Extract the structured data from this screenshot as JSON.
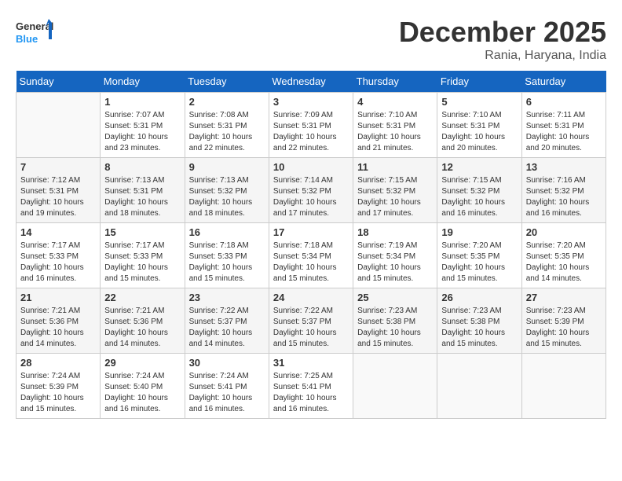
{
  "header": {
    "logo_line1": "General",
    "logo_line2": "Blue",
    "month": "December 2025",
    "location": "Rania, Haryana, India"
  },
  "days_of_week": [
    "Sunday",
    "Monday",
    "Tuesday",
    "Wednesday",
    "Thursday",
    "Friday",
    "Saturday"
  ],
  "weeks": [
    [
      {
        "day": "",
        "sunrise": "",
        "sunset": "",
        "daylight": ""
      },
      {
        "day": "1",
        "sunrise": "Sunrise: 7:07 AM",
        "sunset": "Sunset: 5:31 PM",
        "daylight": "Daylight: 10 hours and 23 minutes."
      },
      {
        "day": "2",
        "sunrise": "Sunrise: 7:08 AM",
        "sunset": "Sunset: 5:31 PM",
        "daylight": "Daylight: 10 hours and 22 minutes."
      },
      {
        "day": "3",
        "sunrise": "Sunrise: 7:09 AM",
        "sunset": "Sunset: 5:31 PM",
        "daylight": "Daylight: 10 hours and 22 minutes."
      },
      {
        "day": "4",
        "sunrise": "Sunrise: 7:10 AM",
        "sunset": "Sunset: 5:31 PM",
        "daylight": "Daylight: 10 hours and 21 minutes."
      },
      {
        "day": "5",
        "sunrise": "Sunrise: 7:10 AM",
        "sunset": "Sunset: 5:31 PM",
        "daylight": "Daylight: 10 hours and 20 minutes."
      },
      {
        "day": "6",
        "sunrise": "Sunrise: 7:11 AM",
        "sunset": "Sunset: 5:31 PM",
        "daylight": "Daylight: 10 hours and 20 minutes."
      }
    ],
    [
      {
        "day": "7",
        "sunrise": "Sunrise: 7:12 AM",
        "sunset": "Sunset: 5:31 PM",
        "daylight": "Daylight: 10 hours and 19 minutes."
      },
      {
        "day": "8",
        "sunrise": "Sunrise: 7:13 AM",
        "sunset": "Sunset: 5:31 PM",
        "daylight": "Daylight: 10 hours and 18 minutes."
      },
      {
        "day": "9",
        "sunrise": "Sunrise: 7:13 AM",
        "sunset": "Sunset: 5:32 PM",
        "daylight": "Daylight: 10 hours and 18 minutes."
      },
      {
        "day": "10",
        "sunrise": "Sunrise: 7:14 AM",
        "sunset": "Sunset: 5:32 PM",
        "daylight": "Daylight: 10 hours and 17 minutes."
      },
      {
        "day": "11",
        "sunrise": "Sunrise: 7:15 AM",
        "sunset": "Sunset: 5:32 PM",
        "daylight": "Daylight: 10 hours and 17 minutes."
      },
      {
        "day": "12",
        "sunrise": "Sunrise: 7:15 AM",
        "sunset": "Sunset: 5:32 PM",
        "daylight": "Daylight: 10 hours and 16 minutes."
      },
      {
        "day": "13",
        "sunrise": "Sunrise: 7:16 AM",
        "sunset": "Sunset: 5:32 PM",
        "daylight": "Daylight: 10 hours and 16 minutes."
      }
    ],
    [
      {
        "day": "14",
        "sunrise": "Sunrise: 7:17 AM",
        "sunset": "Sunset: 5:33 PM",
        "daylight": "Daylight: 10 hours and 16 minutes."
      },
      {
        "day": "15",
        "sunrise": "Sunrise: 7:17 AM",
        "sunset": "Sunset: 5:33 PM",
        "daylight": "Daylight: 10 hours and 15 minutes."
      },
      {
        "day": "16",
        "sunrise": "Sunrise: 7:18 AM",
        "sunset": "Sunset: 5:33 PM",
        "daylight": "Daylight: 10 hours and 15 minutes."
      },
      {
        "day": "17",
        "sunrise": "Sunrise: 7:18 AM",
        "sunset": "Sunset: 5:34 PM",
        "daylight": "Daylight: 10 hours and 15 minutes."
      },
      {
        "day": "18",
        "sunrise": "Sunrise: 7:19 AM",
        "sunset": "Sunset: 5:34 PM",
        "daylight": "Daylight: 10 hours and 15 minutes."
      },
      {
        "day": "19",
        "sunrise": "Sunrise: 7:20 AM",
        "sunset": "Sunset: 5:35 PM",
        "daylight": "Daylight: 10 hours and 15 minutes."
      },
      {
        "day": "20",
        "sunrise": "Sunrise: 7:20 AM",
        "sunset": "Sunset: 5:35 PM",
        "daylight": "Daylight: 10 hours and 14 minutes."
      }
    ],
    [
      {
        "day": "21",
        "sunrise": "Sunrise: 7:21 AM",
        "sunset": "Sunset: 5:36 PM",
        "daylight": "Daylight: 10 hours and 14 minutes."
      },
      {
        "day": "22",
        "sunrise": "Sunrise: 7:21 AM",
        "sunset": "Sunset: 5:36 PM",
        "daylight": "Daylight: 10 hours and 14 minutes."
      },
      {
        "day": "23",
        "sunrise": "Sunrise: 7:22 AM",
        "sunset": "Sunset: 5:37 PM",
        "daylight": "Daylight: 10 hours and 14 minutes."
      },
      {
        "day": "24",
        "sunrise": "Sunrise: 7:22 AM",
        "sunset": "Sunset: 5:37 PM",
        "daylight": "Daylight: 10 hours and 15 minutes."
      },
      {
        "day": "25",
        "sunrise": "Sunrise: 7:23 AM",
        "sunset": "Sunset: 5:38 PM",
        "daylight": "Daylight: 10 hours and 15 minutes."
      },
      {
        "day": "26",
        "sunrise": "Sunrise: 7:23 AM",
        "sunset": "Sunset: 5:38 PM",
        "daylight": "Daylight: 10 hours and 15 minutes."
      },
      {
        "day": "27",
        "sunrise": "Sunrise: 7:23 AM",
        "sunset": "Sunset: 5:39 PM",
        "daylight": "Daylight: 10 hours and 15 minutes."
      }
    ],
    [
      {
        "day": "28",
        "sunrise": "Sunrise: 7:24 AM",
        "sunset": "Sunset: 5:39 PM",
        "daylight": "Daylight: 10 hours and 15 minutes."
      },
      {
        "day": "29",
        "sunrise": "Sunrise: 7:24 AM",
        "sunset": "Sunset: 5:40 PM",
        "daylight": "Daylight: 10 hours and 16 minutes."
      },
      {
        "day": "30",
        "sunrise": "Sunrise: 7:24 AM",
        "sunset": "Sunset: 5:41 PM",
        "daylight": "Daylight: 10 hours and 16 minutes."
      },
      {
        "day": "31",
        "sunrise": "Sunrise: 7:25 AM",
        "sunset": "Sunset: 5:41 PM",
        "daylight": "Daylight: 10 hours and 16 minutes."
      },
      {
        "day": "",
        "sunrise": "",
        "sunset": "",
        "daylight": ""
      },
      {
        "day": "",
        "sunrise": "",
        "sunset": "",
        "daylight": ""
      },
      {
        "day": "",
        "sunrise": "",
        "sunset": "",
        "daylight": ""
      }
    ]
  ]
}
